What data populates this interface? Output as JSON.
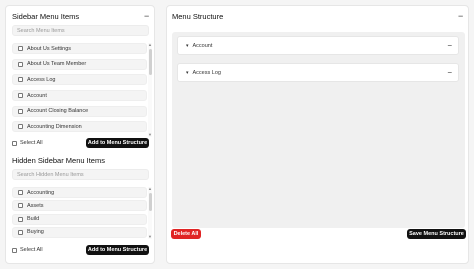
{
  "sidebar": {
    "title": "Sidebar Menu Items",
    "collapse_icon": "minus-icon",
    "search_placeholder": "Search Menu Items",
    "items": [
      {
        "label": "About Us Settings"
      },
      {
        "label": "About Us Team Member"
      },
      {
        "label": "Access Log"
      },
      {
        "label": "Account"
      },
      {
        "label": "Account Closing Balance"
      },
      {
        "label": "Accounting Dimension"
      }
    ],
    "select_all_label": "Select All",
    "add_button_label": "Add to Menu Structure"
  },
  "hidden_sidebar": {
    "title": "Hidden Sidebar Menu Items",
    "search_placeholder": "Search Hidden Menu Items",
    "items": [
      {
        "label": "Accounting"
      },
      {
        "label": "Assets"
      },
      {
        "label": "Build"
      },
      {
        "label": "Buying"
      }
    ],
    "select_all_label": "Select All",
    "add_button_label": "Add to Menu Structure"
  },
  "menu_structure": {
    "title": "Menu Structure",
    "collapse_icon": "minus-icon",
    "items": [
      {
        "label": "Account",
        "expand_icon": "chevron-down-icon"
      },
      {
        "label": "Access Log",
        "expand_icon": "chevron-down-icon"
      }
    ],
    "delete_all_label": "Delete All",
    "save_label": "Save Menu Structure"
  },
  "colors": {
    "primary_button": "#111111",
    "danger_button": "#e02424",
    "background": "#f5f5f5"
  }
}
